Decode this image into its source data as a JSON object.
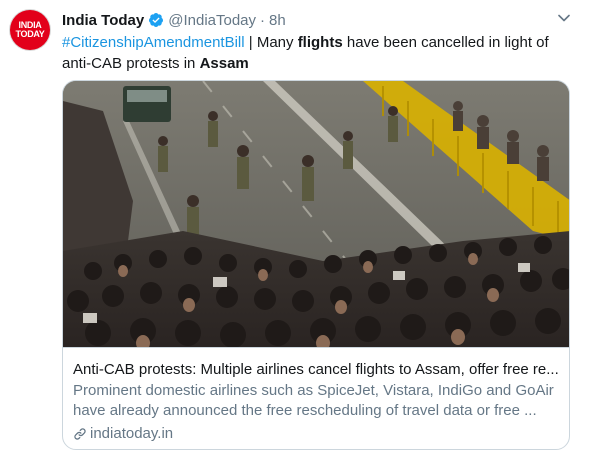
{
  "tweet": {
    "author_name": "India Today",
    "handle": "@IndiaToday",
    "separator": "·",
    "timestamp": "8h",
    "avatar_text_line1": "INDIA",
    "avatar_text_line2": "TODAY",
    "text": {
      "hashtag": "#CitizenshipAmendmentBill",
      "part1": " | Many ",
      "bold1": "flights",
      "part2": " have been cancelled in light of anti-CAB protests in ",
      "bold2": "Assam"
    }
  },
  "card": {
    "title": "Anti-CAB protests: Multiple airlines cancel flights to Assam, offer free re...",
    "description_line1": "Prominent domestic airlines such as SpiceJet, Vistara, IndiGo and GoAir",
    "description_line2": "have already announced the free rescheduling of travel data or free ...",
    "domain": "indiatoday.in"
  },
  "colors": {
    "link": "#1b95e0",
    "secondary_text": "#657786",
    "avatar_bg": "#e2001a",
    "verified": "#1da1f2",
    "border": "#ccd6dd"
  },
  "icons": {
    "verified": "verified-badge-icon",
    "caret": "chevron-down-icon",
    "link": "link-icon"
  }
}
